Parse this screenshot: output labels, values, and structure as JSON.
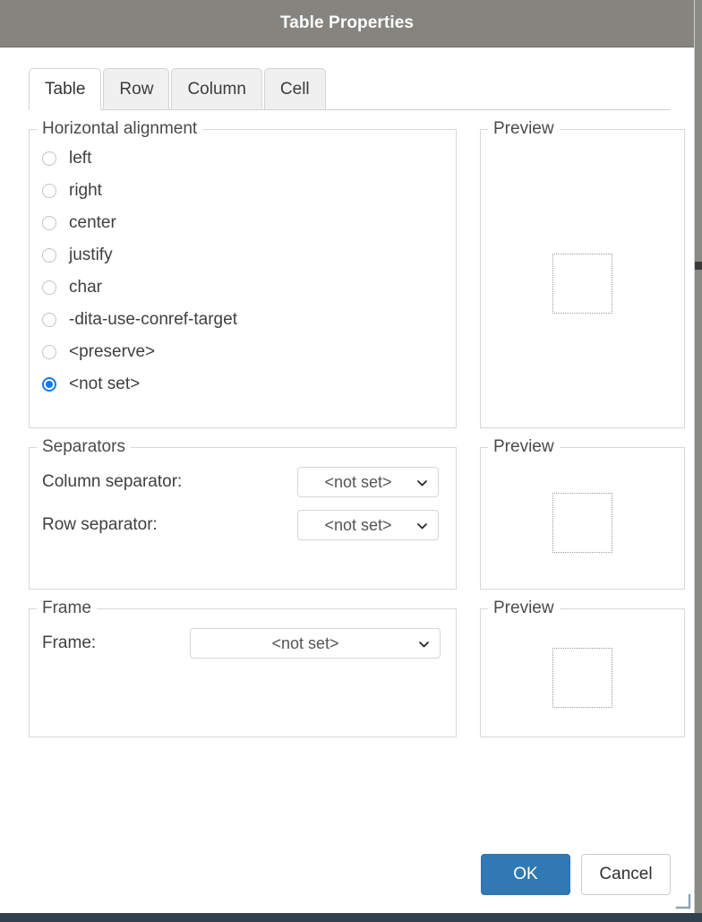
{
  "window": {
    "title": "Table Properties"
  },
  "tabs": [
    {
      "label": "Table",
      "active": true
    },
    {
      "label": "Row",
      "active": false
    },
    {
      "label": "Column",
      "active": false
    },
    {
      "label": "Cell",
      "active": false
    }
  ],
  "horizontal_alignment": {
    "legend": "Horizontal alignment",
    "options": [
      {
        "label": "left",
        "selected": false
      },
      {
        "label": "right",
        "selected": false
      },
      {
        "label": "center",
        "selected": false
      },
      {
        "label": "justify",
        "selected": false
      },
      {
        "label": "char",
        "selected": false
      },
      {
        "label": "-dita-use-conref-target",
        "selected": false
      },
      {
        "label": "<preserve>",
        "selected": false
      },
      {
        "label": "<not set>",
        "selected": true
      }
    ]
  },
  "separators": {
    "legend": "Separators",
    "column_separator": {
      "label": "Column separator:",
      "value": "<not set>",
      "icon": "chevron-down-icon"
    },
    "row_separator": {
      "label": "Row separator:",
      "value": "<not set>",
      "icon": "chevron-down-icon"
    }
  },
  "frame": {
    "legend": "Frame",
    "frame_select": {
      "label": "Frame:",
      "value": "<not set>",
      "icon": "chevron-down-icon"
    }
  },
  "previews": {
    "alignment_legend": "Preview",
    "separators_legend": "Preview",
    "frame_legend": "Preview"
  },
  "footer": {
    "ok_label": "OK",
    "cancel_label": "Cancel"
  },
  "colors": {
    "titlebar": "#85847f",
    "accent_radio": "#1479eb",
    "primary_button": "#3079b5",
    "bottom_strip": "#33414f"
  }
}
